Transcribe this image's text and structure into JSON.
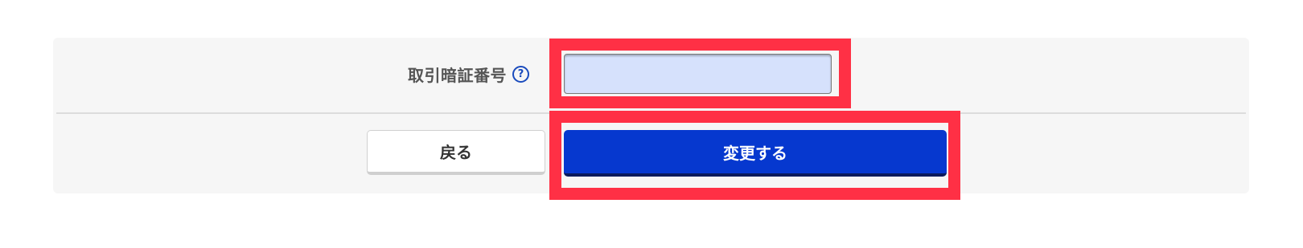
{
  "form": {
    "pin_label": "取引暗証番号",
    "help_icon_glyph": "?",
    "pin_value": "",
    "pin_placeholder": ""
  },
  "actions": {
    "back_label": "戻る",
    "submit_label": "変更する"
  },
  "colors": {
    "panel_bg": "#f6f6f6",
    "input_bg": "#d6e1fc",
    "primary": "#0638cf",
    "highlight": "#ff3045",
    "help_icon": "#1a4bbd"
  },
  "icons": {
    "help": "question-circle-icon"
  }
}
